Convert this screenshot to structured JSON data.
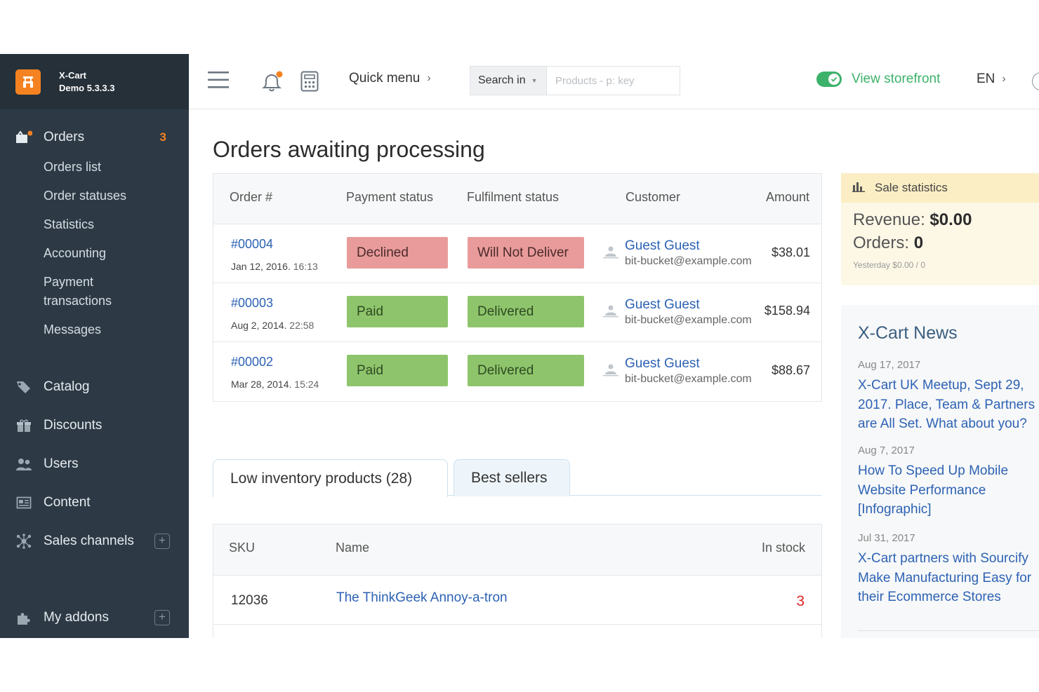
{
  "brand": {
    "name": "X-Cart",
    "version": "Demo 5.3.3.3"
  },
  "sidebar": {
    "orders": {
      "label": "Orders",
      "badge": "3"
    },
    "orders_sub": [
      "Orders list",
      "Order statuses",
      "Statistics",
      "Accounting",
      "Payment",
      "transactions",
      "Messages"
    ],
    "items": [
      {
        "label": "Catalog"
      },
      {
        "label": "Discounts"
      },
      {
        "label": "Users"
      },
      {
        "label": "Content"
      },
      {
        "label": "Sales channels",
        "plus": "+"
      },
      {
        "label": "My addons",
        "plus": "+"
      }
    ]
  },
  "topbar": {
    "quick_menu": "Quick menu",
    "search_in": "Search in",
    "search_placeholder": "Products - p: key",
    "view_storefront": "View storefront",
    "lang": "EN"
  },
  "main": {
    "title": "Orders awaiting processing",
    "orders_columns": [
      "Order #",
      "Payment status",
      "Fulfilment status",
      "Customer",
      "Amount"
    ],
    "orders": [
      {
        "number": "#00004",
        "date": "Jan 12, 2016.",
        "time": "16:13",
        "payment": "Declined",
        "fulfilment": "Will Not Deliver",
        "customer": "Guest Guest",
        "email": "bit-bucket@example.com",
        "amount": "$38.01"
      },
      {
        "number": "#00003",
        "date": "Aug 2, 2014.",
        "time": "22:58",
        "payment": "Paid",
        "fulfilment": "Delivered",
        "customer": "Guest Guest",
        "email": "bit-bucket@example.com",
        "amount": "$158.94"
      },
      {
        "number": "#00002",
        "date": "Mar 28, 2014.",
        "time": "15:24",
        "payment": "Paid",
        "fulfilment": "Delivered",
        "customer": "Guest Guest",
        "email": "bit-bucket@example.com",
        "amount": "$88.67"
      }
    ],
    "tabs": [
      "Low inventory products (28)",
      "Best sellers"
    ],
    "inventory_columns": [
      "SKU",
      "Name",
      "In stock"
    ],
    "inventory": [
      {
        "sku": "12036",
        "name": "The ThinkGeek Annoy-a-tron",
        "stock": "3"
      }
    ]
  },
  "sale_stats": {
    "title": "Sale statistics",
    "revenue_label": "Revenue:",
    "revenue": "$0.00",
    "orders_label": "Orders:",
    "orders": "0",
    "yesterday": "Yesterday",
    "yesterday_value": "$0.00 / 0"
  },
  "news": {
    "title": "X-Cart News",
    "items": [
      {
        "date": "Aug 17, 2017",
        "lines": [
          "X-Cart UK Meetup, Sept 29,",
          "2017. Place, Team & Partners",
          "are All Set. What about you?"
        ]
      },
      {
        "date": "Aug 7, 2017",
        "lines": [
          "How To Speed Up Mobile",
          "Website Performance",
          "[Infographic]"
        ]
      },
      {
        "date": "Jul 31, 2017",
        "lines": [
          "X-Cart partners with Sourcify",
          "Make Manufacturing Easy for",
          "their Ecommerce Stores"
        ]
      }
    ]
  },
  "colors": {
    "accent": "#f58220",
    "sidebar": "#2d3a46",
    "link": "#2d62b4",
    "declined": "#e99b9b",
    "paid": "#8ec56c",
    "storefront": "#3db26b",
    "stock_low": "#e02424"
  }
}
